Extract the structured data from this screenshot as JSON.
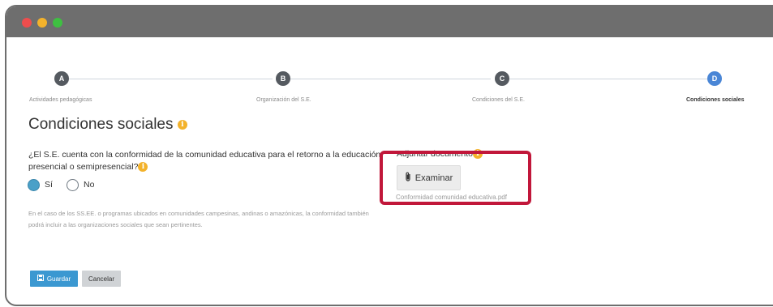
{
  "window": {
    "controls": [
      "close",
      "minimize",
      "maximize"
    ],
    "control_colors": [
      "#ee4d4d",
      "#f3b22b",
      "#3ec041"
    ]
  },
  "stepper": {
    "steps": [
      {
        "letter": "A",
        "label": "Actividades pedagógicas",
        "active": false
      },
      {
        "letter": "B",
        "label": "Organización del S.E.",
        "active": false
      },
      {
        "letter": "C",
        "label": "Condiciones del S.E.",
        "active": false
      },
      {
        "letter": "D",
        "label": "Condiciones sociales",
        "active": true
      }
    ],
    "active_color": "#4a86d6"
  },
  "section": {
    "title": "Condiciones sociales",
    "info_icon": "i"
  },
  "question": {
    "text": "¿El S.E. cuenta con la conformidad de la comunidad educativa para el retorno a la educación presencial o semipresencial?",
    "info_icon": "i",
    "options": [
      {
        "label": "Sí",
        "selected": true
      },
      {
        "label": "No",
        "selected": false
      }
    ]
  },
  "help_text": "En el caso de los SS.EE. o programas ubicados en comunidades campesinas, andinas o amazónicas, la conformidad también podrá incluir a las organizaciones sociales que sean pertinentes.",
  "attachment": {
    "label": "Adjuntar documento",
    "info_icon": "i",
    "browse_label": "Examinar",
    "file_name": "Conformidad comunidad educativa.pdf"
  },
  "actions": {
    "save_label": "Guardar",
    "cancel_label": "Cancelar"
  },
  "colors": {
    "save_button": "#3b98d1",
    "info_icon": "#f3b22b",
    "highlight_box": "#c1173a"
  }
}
